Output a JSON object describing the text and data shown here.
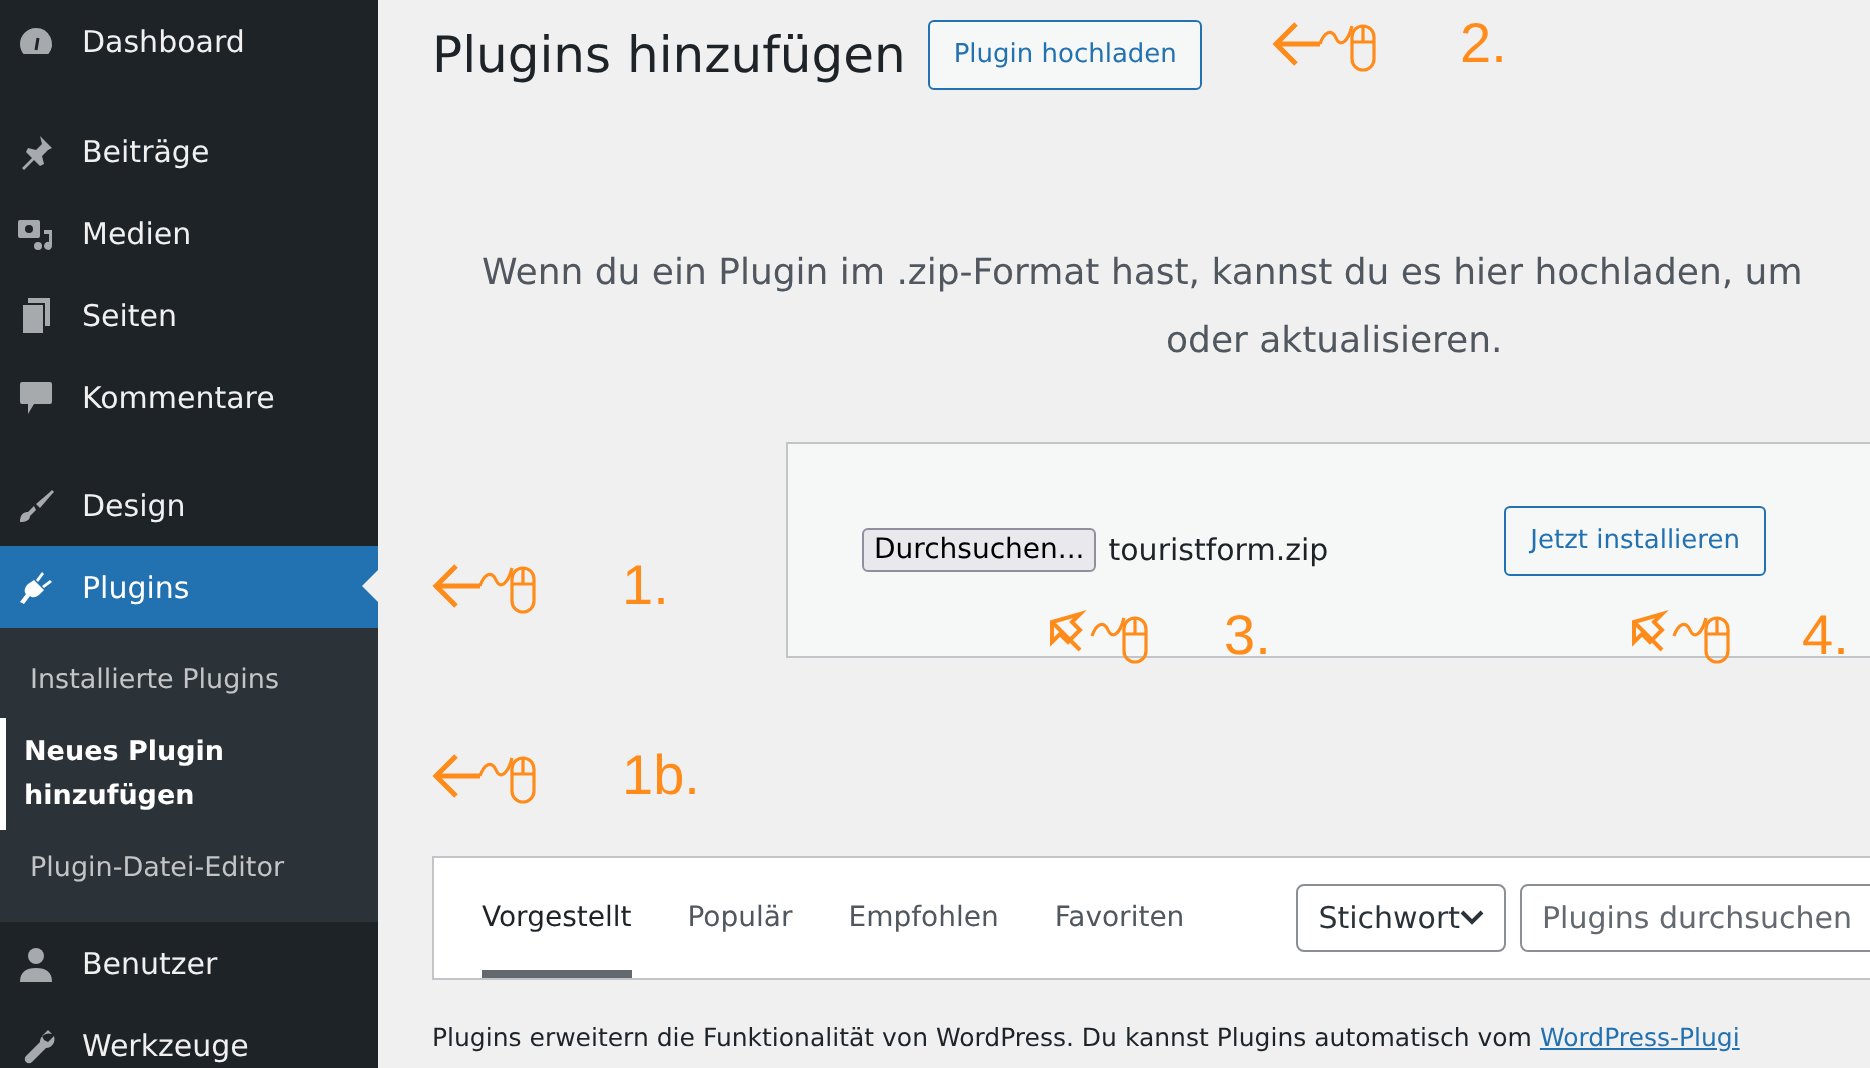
{
  "sidebar": {
    "groups": [
      [
        {
          "label": "Dashboard",
          "selected": false
        }
      ],
      [
        {
          "label": "Beiträge",
          "selected": false
        },
        {
          "label": "Medien",
          "selected": false
        },
        {
          "label": "Seiten",
          "selected": false
        },
        {
          "label": "Kommentare",
          "selected": false
        }
      ],
      [
        {
          "label": "Design",
          "selected": false
        },
        {
          "label": "Plugins",
          "selected": true,
          "children": [
            {
              "label": "Installierte Plugins",
              "selected": false
            },
            {
              "label": "Neues Plugin hinzufügen",
              "selected": true
            },
            {
              "label": "Plugin-Datei-Editor",
              "selected": false
            }
          ]
        },
        {
          "label": "Benutzer",
          "selected": false
        },
        {
          "label": "Werkzeuge",
          "selected": false
        }
      ]
    ]
  },
  "header": {
    "title": "Plugins hinzufügen",
    "button": "Plugin hochladen"
  },
  "upload": {
    "description": [
      "Wenn du ein Plugin im .zip-Format hast, kannst du es hier hochladen, um",
      "oder aktualisieren."
    ],
    "browse_button": "Durchsuchen...",
    "file_name": "touristform.zip",
    "install_button": "Jetzt installieren"
  },
  "tabs": [
    {
      "label": "Vorgestellt",
      "selected": true
    },
    {
      "label": "Populär",
      "selected": false
    },
    {
      "label": "Empfohlen",
      "selected": false
    },
    {
      "label": "Favoriten",
      "selected": false
    }
  ],
  "filter": {
    "select": "Stichwort",
    "search": {
      "placeholder": "Plugins durchsuchen"
    }
  },
  "footer": {
    "text": "Plugins erweitern die Funktionalität von WordPress. Du kannst Plugins automatisch vom",
    "link": "WordPress-Plugi"
  },
  "annotations": [
    {
      "label": "1.",
      "kind": "left"
    },
    {
      "label": "1b.",
      "kind": "left"
    },
    {
      "label": "2.",
      "kind": "left"
    },
    {
      "label": "3.",
      "kind": "diagonal"
    },
    {
      "label": "4.",
      "kind": "diagonal"
    }
  ]
}
